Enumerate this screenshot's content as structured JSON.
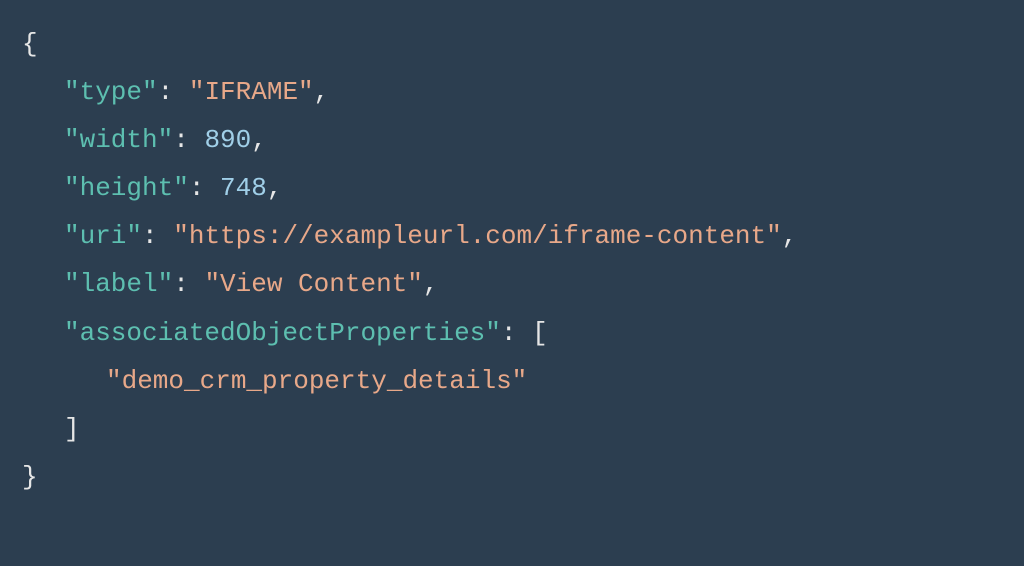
{
  "code": {
    "open_brace": "{",
    "close_brace": "}",
    "open_bracket": "[",
    "close_bracket": "]",
    "colon_space": ": ",
    "comma": ",",
    "keys": {
      "type": "\"type\"",
      "width": "\"width\"",
      "height": "\"height\"",
      "uri": "\"uri\"",
      "label": "\"label\"",
      "associatedObjectProperties": "\"associatedObjectProperties\""
    },
    "values": {
      "type": "\"IFRAME\"",
      "width": "890",
      "height": "748",
      "uri": "\"https://exampleurl.com/iframe-content\"",
      "label": "\"View Content\"",
      "arrayItem0": "\"demo_crm_property_details\""
    }
  }
}
